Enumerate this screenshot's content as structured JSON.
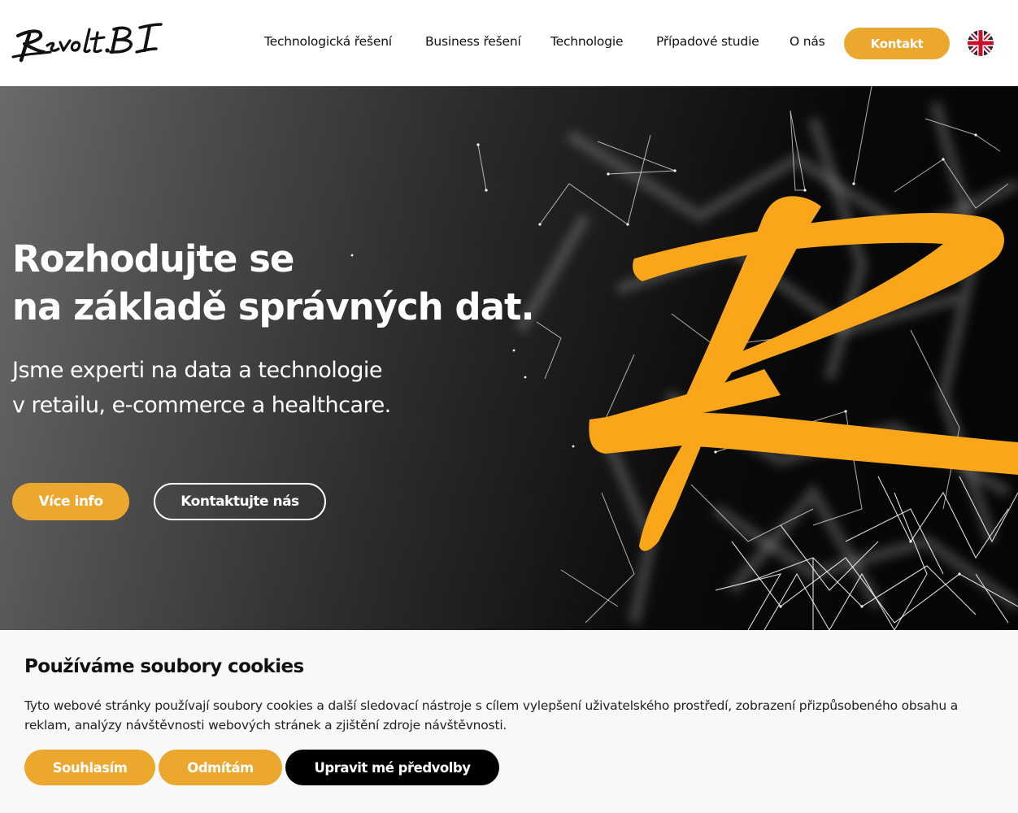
{
  "brand": {
    "logo_text": "Revolt.BI",
    "accent": "#eca72f",
    "dark": "#000000"
  },
  "nav": {
    "items": [
      {
        "label": "Technologická řešení"
      },
      {
        "label": "Business řešení"
      },
      {
        "label": "Technologie"
      },
      {
        "label": "Případové studie"
      },
      {
        "label": "O nás"
      }
    ],
    "cta_label": "Kontakt",
    "language_icon": "uk-flag-icon"
  },
  "hero": {
    "title_lines": [
      "Rozhodujte se",
      "na základě správných dat."
    ],
    "subtitle_lines": [
      "Jsme experti na data a technologie",
      "v retailu, e-commerce a healthcare."
    ],
    "primary_button": "Více info",
    "secondary_button": "Kontaktujte nás",
    "graphic": "revolt-r-brush-mark"
  },
  "cookie_banner": {
    "title": "Používáme soubory cookies",
    "text": "Tyto webové stránky používají soubory cookies a další sledovací nástroje s cílem vylepšení uživatelského prostředí, zobrazení přizpůsobeného obsahu a reklam, analýzy návštěvnosti webových stránek a zjištění zdroje návštěvnosti.",
    "accept_label": "Souhlasím",
    "reject_label": "Odmítám",
    "preferences_label": "Upravit mé předvolby"
  }
}
